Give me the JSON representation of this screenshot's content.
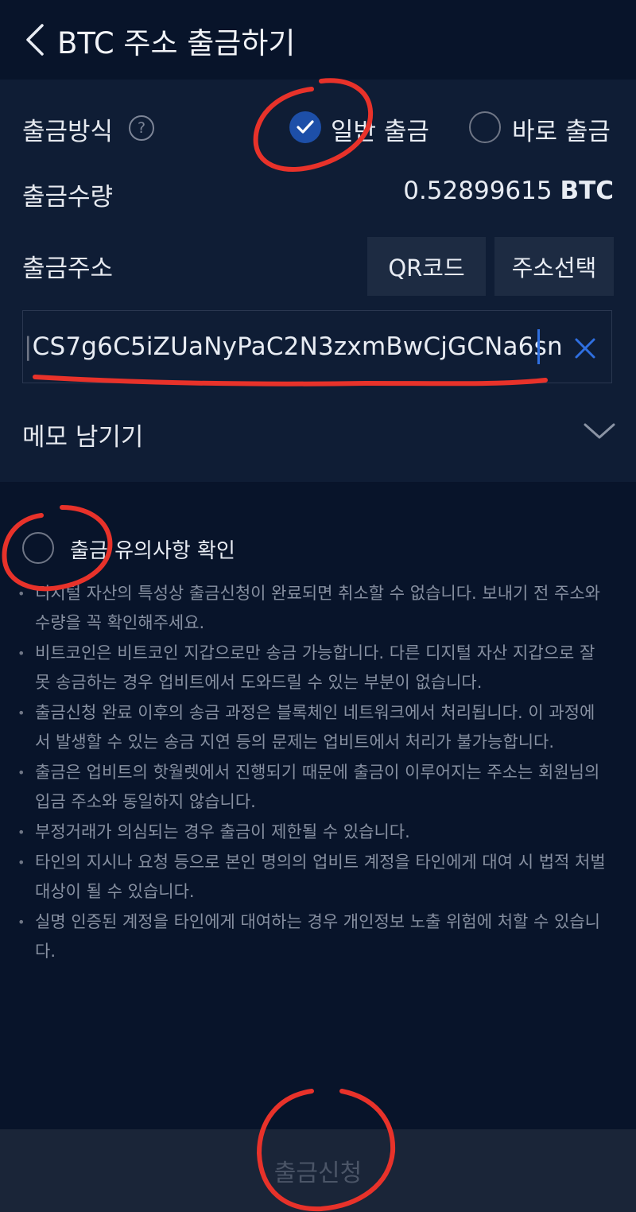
{
  "header": {
    "title": "BTC 주소 출금하기"
  },
  "withdraw_method": {
    "label": "출금방식",
    "help_icon": "?",
    "options": [
      {
        "label": "일반 출금",
        "selected": true
      },
      {
        "label": "바로 출금",
        "selected": false
      }
    ]
  },
  "amount": {
    "label": "출금수량",
    "value": "0.52899615",
    "unit": "BTC"
  },
  "address": {
    "label": "출금주소",
    "qr_button": "QR코드",
    "select_button": "주소선택",
    "value": "CS7g6C5iZUaNyPaC2N3zxmBwCjGCNa6sn"
  },
  "memo": {
    "label": "메모 남기기"
  },
  "notice": {
    "title": "출금 유의사항 확인",
    "items": [
      "디지털 자산의 특성상 출금신청이 완료되면 취소할 수 없습니다. 보내기 전 주소와 수량을 꼭 확인해주세요.",
      "비트코인은 비트코인 지갑으로만 송금 가능합니다. 다른 디지털 자산 지갑으로 잘못 송금하는 경우 업비트에서 도와드릴 수 있는 부분이 없습니다.",
      "출금신청 완료 이후의 송금 과정은 블록체인 네트워크에서 처리됩니다. 이 과정에서 발생할 수 있는 송금 지연 등의 문제는 업비트에서 처리가 불가능합니다.",
      "출금은 업비트의 핫월렛에서 진행되기 때문에 출금이 이루어지는 주소는 회원님의 입금 주소와 동일하지 않습니다.",
      "부정거래가 의심되는 경우 출금이 제한될 수 있습니다.",
      "타인의 지시나 요청 등으로 본인 명의의 업비트 계정을 타인에게 대여 시 법적 처벌 대상이 될 수 있습니다.",
      "실명 인증된 계정을 타인에게 대여하는 경우 개인정보 노출 위험에 처할 수 있습니다."
    ]
  },
  "submit": {
    "label": "출금신청"
  },
  "colors": {
    "background": "#08142a",
    "panel": "#0f1d35",
    "accent": "#1d4fa8",
    "annotation": "#e8322a"
  }
}
